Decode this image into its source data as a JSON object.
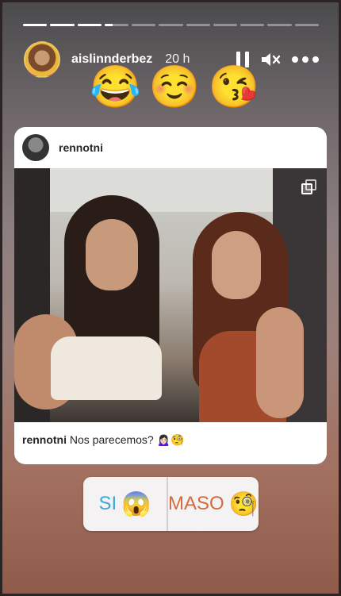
{
  "story": {
    "progress": [
      1,
      1,
      1,
      0.35,
      0,
      0,
      0,
      0,
      0,
      0,
      0
    ],
    "username": "aislinnderbez",
    "time": "20 h",
    "icons": {
      "pause": "pause-icon",
      "mute": "mute-icon",
      "more": "more-icon"
    },
    "sticker_emojis": "😂☺️😘"
  },
  "post": {
    "username": "rennotni",
    "caption_user": "rennotni",
    "caption_text": "Nos parecemos? 🙍🏻‍♀️🧐",
    "icons": {
      "multi": "multiple-images-icon"
    }
  },
  "poll": {
    "option_1": "SI",
    "option_1_emoji": "😱",
    "option_2": "MASO",
    "option_2_emoji": "🧐"
  }
}
